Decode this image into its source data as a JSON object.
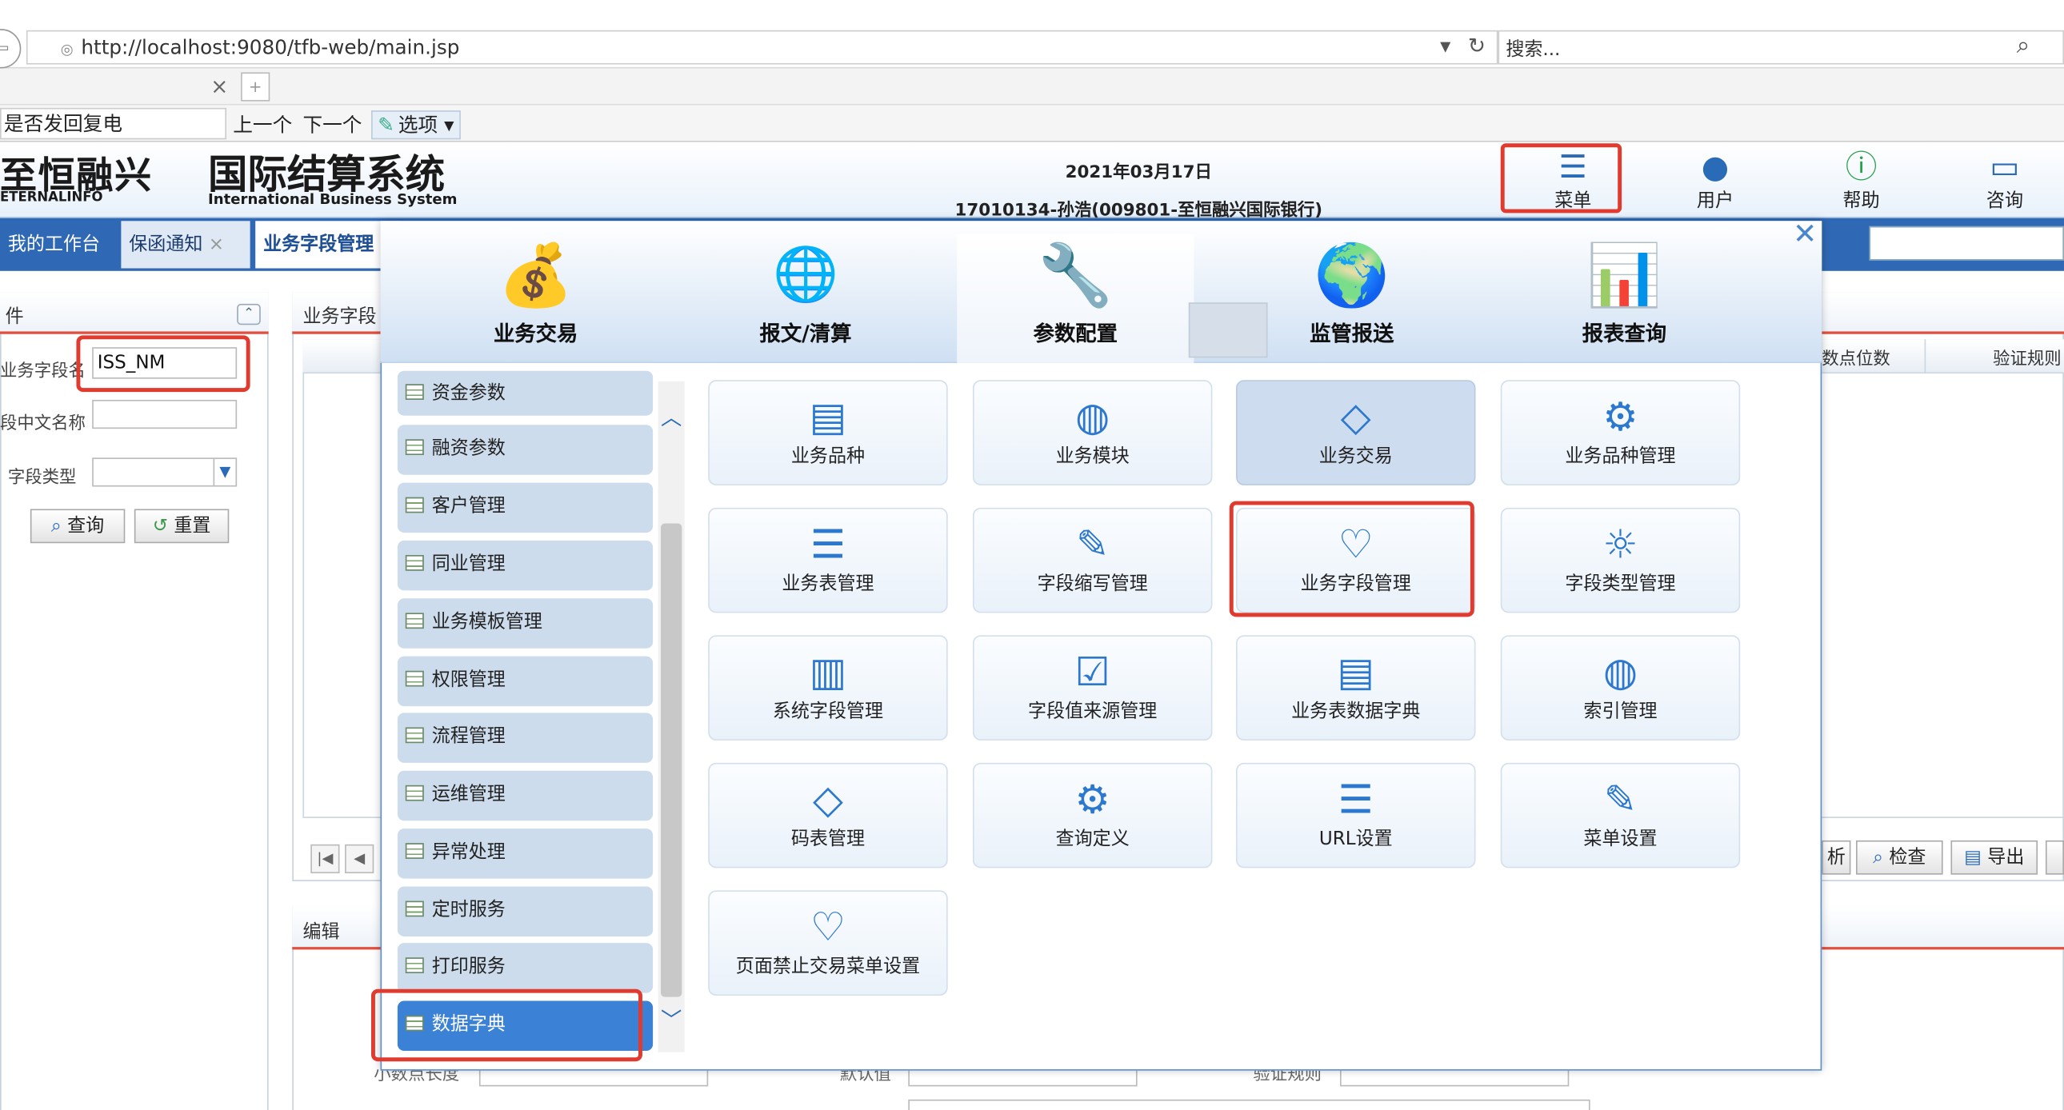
{
  "browser": {
    "url": "http://localhost:9080/tfb-web/main.jsp",
    "search_placeholder": "搜索...",
    "find_value": "是否发回复电",
    "find_prev": "上一个",
    "find_next": "下一个",
    "find_options": "选项"
  },
  "header": {
    "logo_cn": "至恒融兴",
    "logo_en": "ETERNALINFO",
    "system_cn": "国际结算系统",
    "system_en": "International Business System",
    "date": "2021年03月17日",
    "user": "17010134-孙浩(009801-至恒融兴国际银行)",
    "icons": [
      {
        "label": "菜单",
        "icon": "list-icon"
      },
      {
        "label": "用户",
        "icon": "user-icon"
      },
      {
        "label": "帮助",
        "icon": "help-icon"
      },
      {
        "label": "咨询",
        "icon": "chat-icon"
      }
    ]
  },
  "app_tabs": [
    "我的工作台",
    "保函通知",
    "业务字段管理"
  ],
  "query_panel": {
    "title": "件",
    "field1_label": "业务字段名",
    "field1_value": "ISS_NM",
    "field2_label": "段中文名称",
    "field3_label": "字段类型",
    "query_btn": "查询",
    "reset_btn": "重置"
  },
  "list_panel": {
    "title": "业务字段",
    "col_decimal": "数点位数",
    "col_validate": "验证规则",
    "btn_analyze": "析",
    "btn_check": "检查",
    "btn_export": "导出"
  },
  "edit_panel": {
    "title": "编辑",
    "label_decimal_len": "小数点长度",
    "label_default": "默认值",
    "label_rule": "验证规则"
  },
  "menu": {
    "categories": [
      {
        "label": "业务交易"
      },
      {
        "label": "报文/清算"
      },
      {
        "label": "参数配置"
      },
      {
        "label": "监管报送"
      },
      {
        "label": "报表查询"
      }
    ],
    "side_items": [
      "资金参数",
      "融资参数",
      "客户管理",
      "同业管理",
      "业务模板管理",
      "权限管理",
      "流程管理",
      "运维管理",
      "异常处理",
      "定时服务",
      "打印服务",
      "数据字典"
    ],
    "cards": [
      {
        "label": "业务品种",
        "icon": "id-card-icon"
      },
      {
        "label": "业务模块",
        "icon": "basketball-icon"
      },
      {
        "label": "业务交易",
        "icon": "diamond-icon"
      },
      {
        "label": "业务品种管理",
        "icon": "gear-icon"
      },
      {
        "label": "业务表管理",
        "icon": "list-icon"
      },
      {
        "label": "字段缩写管理",
        "icon": "edit-icon"
      },
      {
        "label": "业务字段管理",
        "icon": "heart-icon"
      },
      {
        "label": "字段类型管理",
        "icon": "sun-icon"
      },
      {
        "label": "系统字段管理",
        "icon": "document-icon"
      },
      {
        "label": "字段值来源管理",
        "icon": "monitor-check-icon"
      },
      {
        "label": "业务表数据字典",
        "icon": "id-card-icon"
      },
      {
        "label": "索引管理",
        "icon": "basketball-icon"
      },
      {
        "label": "码表管理",
        "icon": "diamond-icon"
      },
      {
        "label": "查询定义",
        "icon": "gear-icon"
      },
      {
        "label": "URL设置",
        "icon": "list-icon"
      },
      {
        "label": "菜单设置",
        "icon": "edit-icon"
      },
      {
        "label": "页面禁止交易菜单设置",
        "icon": "heart-icon"
      }
    ]
  },
  "colors": {
    "accent": "#2f68b4",
    "highlight": "#e03b2e",
    "icon": "#2c78cf"
  }
}
